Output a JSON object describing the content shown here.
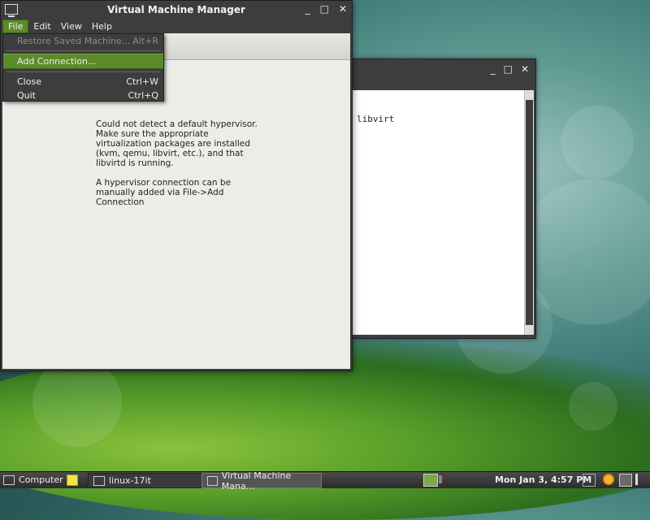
{
  "vmm_window": {
    "title": "Virtual Machine Manager",
    "controls": {
      "minimize": "_",
      "maximize": "□",
      "close": "✕"
    },
    "menubar": [
      "File",
      "Edit",
      "View",
      "Help"
    ],
    "message_p1": "Could not detect a default hypervisor. Make sure the appropriate virtualization packages are installed (kvm, qemu, libvirt, etc.), and that libvirtd is running.",
    "message_p2": "A hypervisor connection can be manually added via File->Add Connection"
  },
  "file_menu": {
    "items": [
      {
        "label": "Restore Saved Machine...",
        "shortcut": "Alt+R",
        "disabled": true
      },
      {
        "label": "Add Connection...",
        "shortcut": "",
        "hover": true
      },
      {
        "label": "Close",
        "shortcut": "Ctrl+W"
      },
      {
        "label": "Quit",
        "shortcut": "Ctrl+Q"
      }
    ]
  },
  "terminal_window": {
    "text": "libvirt",
    "controls": {
      "minimize": "_",
      "maximize": "□",
      "close": "✕"
    }
  },
  "taskbar": {
    "computer_label": "Computer",
    "tasks": [
      "linux-17it",
      "Virtual Machine Mana..."
    ],
    "clock": "Mon Jan  3,  4:57 PM"
  },
  "colors": {
    "accent": "#5d8a2b",
    "panel": "#3d3d3d"
  }
}
